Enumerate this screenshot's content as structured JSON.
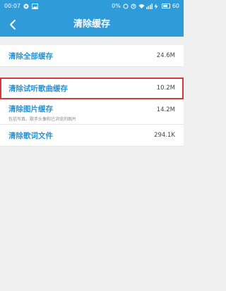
{
  "status": {
    "time": "00:07",
    "percent": "0%",
    "battery": "60"
  },
  "header": {
    "title": "清除缓存"
  },
  "groups": [
    {
      "items": [
        {
          "label": "清除全部缓存",
          "size": "24.6M"
        }
      ]
    },
    {
      "items": [
        {
          "label": "清除试听歌曲缓存",
          "size": "10.2M",
          "highlighted": true
        },
        {
          "label": "清除图片缓存",
          "desc": "包括写真、歌手头像和已浏览的图片",
          "size": "14.2M"
        },
        {
          "label": "清除歌词文件",
          "size": "294.1K"
        }
      ]
    }
  ],
  "colors": {
    "header_bg": "#2f9bd8",
    "label_blue": "#2a92d0",
    "highlight_border": "#d33a3a"
  }
}
